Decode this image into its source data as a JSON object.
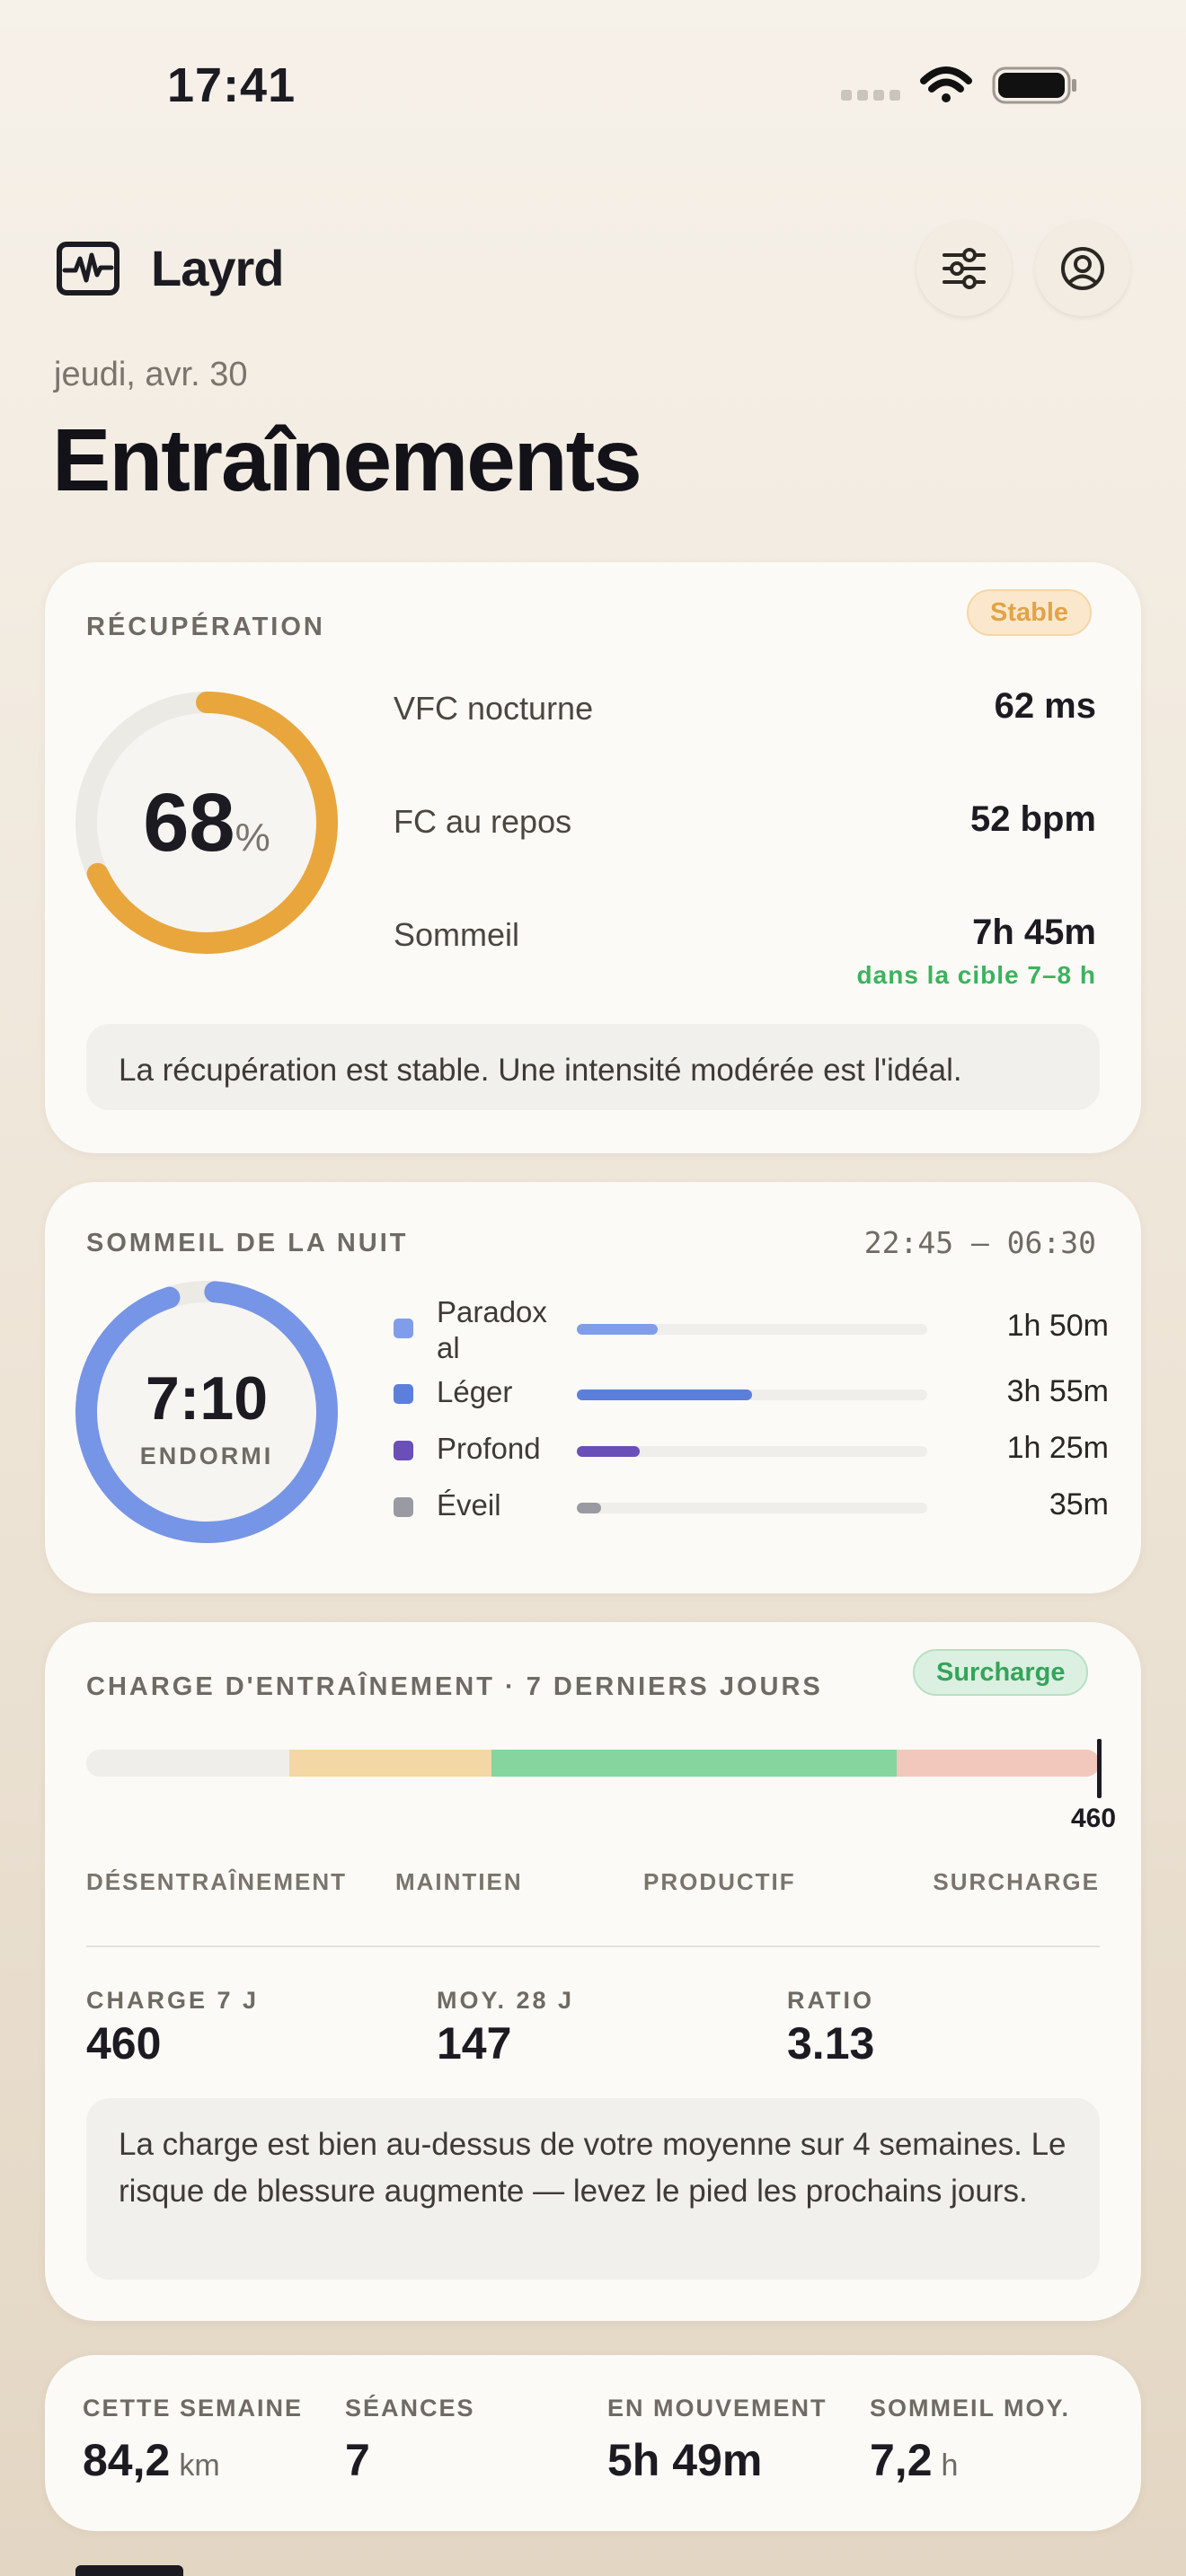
{
  "status_bar": {
    "time": "17:41"
  },
  "header": {
    "app_name": "Layrd",
    "date": "jeudi, avr. 30",
    "title": "Entraînements",
    "icons": [
      "activity-icon",
      "sliders-icon",
      "profile-icon"
    ]
  },
  "recovery": {
    "label": "RÉCUPÉRATION",
    "badge": "Stable",
    "score": "68",
    "score_unit": "%",
    "score_fraction": 0.68,
    "ring_color": "#e8a63d",
    "metrics": [
      {
        "label": "VFC nocturne",
        "value": "62 ms"
      },
      {
        "label": "FC au repos",
        "value": "52 bpm"
      },
      {
        "label": "Sommeil",
        "value": "7h 45m"
      }
    ],
    "sleep_note": "dans la cible 7–8 h",
    "message": "La récupération est stable. Une intensité modérée est l'idéal."
  },
  "sleep": {
    "label": "SOMMEIL DE LA NUIT",
    "range": "22:45 — 06:30",
    "total": "7:10",
    "total_label": "ENDORMI",
    "ring_color": "#7795e6",
    "stages": [
      {
        "name": "Paradox\nal",
        "duration": "1h 50m",
        "color": "#7f9de8",
        "fraction": 0.23
      },
      {
        "name": "Léger",
        "duration": "3h 55m",
        "color": "#5b7fdb",
        "fraction": 0.5
      },
      {
        "name": "Profond",
        "duration": "1h 25m",
        "color": "#6a4fb8",
        "fraction": 0.18
      },
      {
        "name": "Éveil",
        "duration": "35m",
        "color": "#9a9aa2",
        "fraction": 0.07
      }
    ]
  },
  "load": {
    "label": "CHARGE D'ENTRAÎNEMENT · 7 DERNIERS JOURS",
    "badge": "Surcharge",
    "marker_value": "460",
    "zones": [
      "DÉSENTRAÎNEMENT",
      "MAINTIEN",
      "PRODUCTIF",
      "SURCHARGE"
    ],
    "zone_colors": [
      "#efeeeb",
      "#f3d7a4",
      "#86d59e",
      "#f2c8bd"
    ],
    "stats": [
      {
        "label": "CHARGE 7 J",
        "value": "460"
      },
      {
        "label": "MOY. 28 J",
        "value": "147"
      },
      {
        "label": "RATIO",
        "value": "3.13"
      }
    ],
    "message": "La charge est bien au-dessus de votre moyenne sur 4 semaines. Le risque de blessure augmente — levez le pied les prochains jours."
  },
  "summary": [
    {
      "label": "CETTE SEMAINE",
      "value": "84,2",
      "unit": "km"
    },
    {
      "label": "SÉANCES",
      "value": "7",
      "unit": ""
    },
    {
      "label": "EN MOUVEMENT",
      "value": "5h 49m",
      "unit": ""
    },
    {
      "label": "SOMMEIL MOY.",
      "value": "7,2",
      "unit": "h"
    }
  ]
}
